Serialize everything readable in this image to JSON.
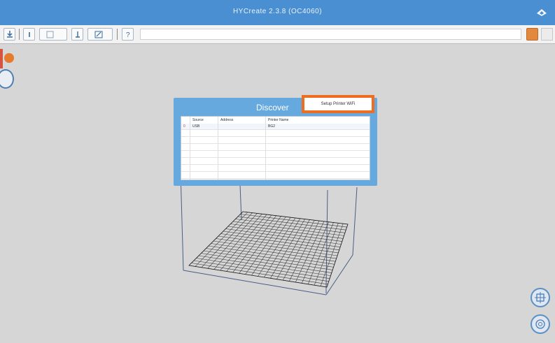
{
  "window": {
    "title": "HYCreate 2.3.8 (OC4060)"
  },
  "toolbar": {
    "buttons": [
      "download-icon",
      "info-icon",
      "grid-icon",
      "list-icon",
      "edit-icon",
      "help-icon"
    ]
  },
  "dialog": {
    "title": "Discover",
    "setup_button_label": "Setup Printer WiFi",
    "columns": [
      "Source",
      "Address",
      "Printer Name"
    ],
    "rows": [
      {
        "marker": "0",
        "source": "USB",
        "address": "",
        "printer_name": "BG2"
      }
    ]
  },
  "colors": {
    "titlebar": "#4a8fd2",
    "dialog": "#66a9df",
    "highlight": "#ee6d1f"
  }
}
